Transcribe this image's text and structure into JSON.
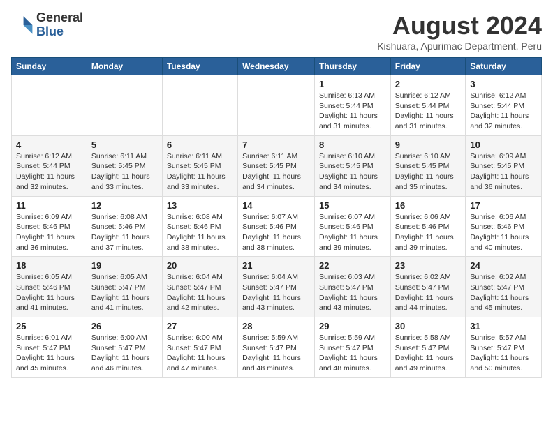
{
  "logo": {
    "general": "General",
    "blue": "Blue"
  },
  "title": "August 2024",
  "location": "Kishuara, Apurimac Department, Peru",
  "weekdays": [
    "Sunday",
    "Monday",
    "Tuesday",
    "Wednesday",
    "Thursday",
    "Friday",
    "Saturday"
  ],
  "weeks": [
    [
      {
        "day": "",
        "info": ""
      },
      {
        "day": "",
        "info": ""
      },
      {
        "day": "",
        "info": ""
      },
      {
        "day": "",
        "info": ""
      },
      {
        "day": "1",
        "sunrise": "6:13 AM",
        "sunset": "5:44 PM",
        "daylight": "11 hours and 31 minutes."
      },
      {
        "day": "2",
        "sunrise": "6:12 AM",
        "sunset": "5:44 PM",
        "daylight": "11 hours and 31 minutes."
      },
      {
        "day": "3",
        "sunrise": "6:12 AM",
        "sunset": "5:44 PM",
        "daylight": "11 hours and 32 minutes."
      }
    ],
    [
      {
        "day": "4",
        "sunrise": "6:12 AM",
        "sunset": "5:44 PM",
        "daylight": "11 hours and 32 minutes."
      },
      {
        "day": "5",
        "sunrise": "6:11 AM",
        "sunset": "5:45 PM",
        "daylight": "11 hours and 33 minutes."
      },
      {
        "day": "6",
        "sunrise": "6:11 AM",
        "sunset": "5:45 PM",
        "daylight": "11 hours and 33 minutes."
      },
      {
        "day": "7",
        "sunrise": "6:11 AM",
        "sunset": "5:45 PM",
        "daylight": "11 hours and 34 minutes."
      },
      {
        "day": "8",
        "sunrise": "6:10 AM",
        "sunset": "5:45 PM",
        "daylight": "11 hours and 34 minutes."
      },
      {
        "day": "9",
        "sunrise": "6:10 AM",
        "sunset": "5:45 PM",
        "daylight": "11 hours and 35 minutes."
      },
      {
        "day": "10",
        "sunrise": "6:09 AM",
        "sunset": "5:45 PM",
        "daylight": "11 hours and 36 minutes."
      }
    ],
    [
      {
        "day": "11",
        "sunrise": "6:09 AM",
        "sunset": "5:46 PM",
        "daylight": "11 hours and 36 minutes."
      },
      {
        "day": "12",
        "sunrise": "6:08 AM",
        "sunset": "5:46 PM",
        "daylight": "11 hours and 37 minutes."
      },
      {
        "day": "13",
        "sunrise": "6:08 AM",
        "sunset": "5:46 PM",
        "daylight": "11 hours and 38 minutes."
      },
      {
        "day": "14",
        "sunrise": "6:07 AM",
        "sunset": "5:46 PM",
        "daylight": "11 hours and 38 minutes."
      },
      {
        "day": "15",
        "sunrise": "6:07 AM",
        "sunset": "5:46 PM",
        "daylight": "11 hours and 39 minutes."
      },
      {
        "day": "16",
        "sunrise": "6:06 AM",
        "sunset": "5:46 PM",
        "daylight": "11 hours and 39 minutes."
      },
      {
        "day": "17",
        "sunrise": "6:06 AM",
        "sunset": "5:46 PM",
        "daylight": "11 hours and 40 minutes."
      }
    ],
    [
      {
        "day": "18",
        "sunrise": "6:05 AM",
        "sunset": "5:46 PM",
        "daylight": "11 hours and 41 minutes."
      },
      {
        "day": "19",
        "sunrise": "6:05 AM",
        "sunset": "5:47 PM",
        "daylight": "11 hours and 41 minutes."
      },
      {
        "day": "20",
        "sunrise": "6:04 AM",
        "sunset": "5:47 PM",
        "daylight": "11 hours and 42 minutes."
      },
      {
        "day": "21",
        "sunrise": "6:04 AM",
        "sunset": "5:47 PM",
        "daylight": "11 hours and 43 minutes."
      },
      {
        "day": "22",
        "sunrise": "6:03 AM",
        "sunset": "5:47 PM",
        "daylight": "11 hours and 43 minutes."
      },
      {
        "day": "23",
        "sunrise": "6:02 AM",
        "sunset": "5:47 PM",
        "daylight": "11 hours and 44 minutes."
      },
      {
        "day": "24",
        "sunrise": "6:02 AM",
        "sunset": "5:47 PM",
        "daylight": "11 hours and 45 minutes."
      }
    ],
    [
      {
        "day": "25",
        "sunrise": "6:01 AM",
        "sunset": "5:47 PM",
        "daylight": "11 hours and 45 minutes."
      },
      {
        "day": "26",
        "sunrise": "6:00 AM",
        "sunset": "5:47 PM",
        "daylight": "11 hours and 46 minutes."
      },
      {
        "day": "27",
        "sunrise": "6:00 AM",
        "sunset": "5:47 PM",
        "daylight": "11 hours and 47 minutes."
      },
      {
        "day": "28",
        "sunrise": "5:59 AM",
        "sunset": "5:47 PM",
        "daylight": "11 hours and 48 minutes."
      },
      {
        "day": "29",
        "sunrise": "5:59 AM",
        "sunset": "5:47 PM",
        "daylight": "11 hours and 48 minutes."
      },
      {
        "day": "30",
        "sunrise": "5:58 AM",
        "sunset": "5:47 PM",
        "daylight": "11 hours and 49 minutes."
      },
      {
        "day": "31",
        "sunrise": "5:57 AM",
        "sunset": "5:47 PM",
        "daylight": "11 hours and 50 minutes."
      }
    ]
  ],
  "labels": {
    "sunrise": "Sunrise:",
    "sunset": "Sunset:",
    "daylight": "Daylight hours"
  }
}
